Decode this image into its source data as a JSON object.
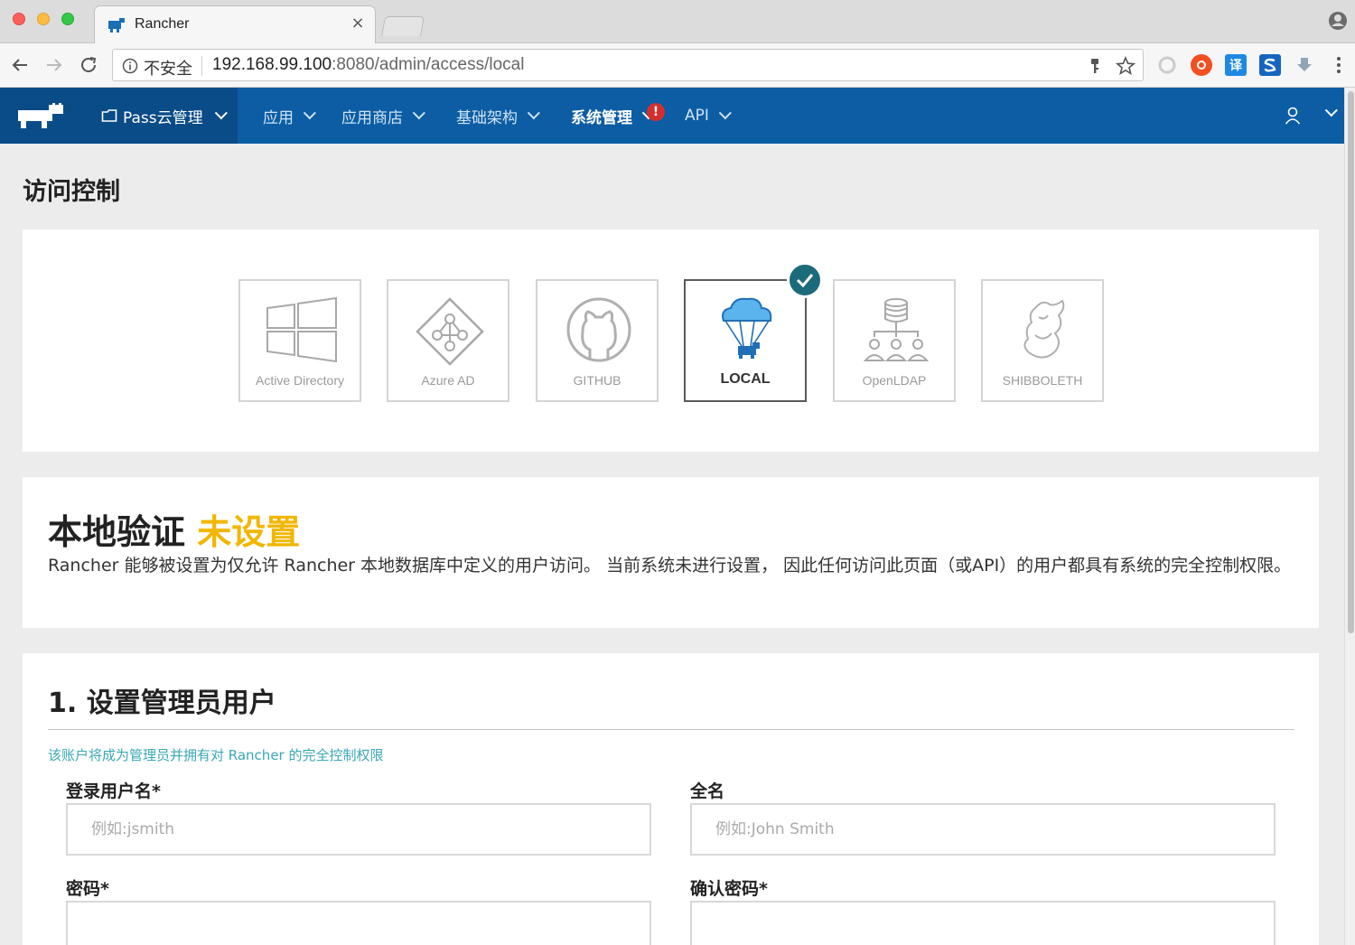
{
  "browser": {
    "tab_title": "Rancher",
    "tab_close": "×",
    "security_label": "不安全",
    "url_host": "192.168.99.100",
    "url_rest": ":8080/admin/access/local",
    "extension_translate": "译"
  },
  "header": {
    "env_label": "Pass云管理",
    "nav": [
      {
        "label": "应用"
      },
      {
        "label": "应用商店"
      },
      {
        "label": "基础架构"
      },
      {
        "label": "系统管理",
        "active": true
      },
      {
        "label": "API"
      }
    ],
    "alert_badge": "!"
  },
  "page": {
    "title": "访问控制"
  },
  "providers": [
    {
      "label": "Active Directory",
      "icon": "windows-icon"
    },
    {
      "label": "Azure AD",
      "icon": "azure-icon"
    },
    {
      "label": "GITHUB",
      "icon": "github-icon"
    },
    {
      "label": "LOCAL",
      "icon": "local-cloud-icon",
      "selected": true
    },
    {
      "label": "OpenLDAP",
      "icon": "ldap-icon"
    },
    {
      "label": "SHIBBOLETH",
      "icon": "shibboleth-icon"
    }
  ],
  "status": {
    "title": "本地验证",
    "state": "未设置",
    "description": "Rancher 能够被设置为仅允许 Rancher 本地数据库中定义的用户访问。 当前系统未进行设置， 因此任何访问此页面（或API）的用户都具有系统的完全控制权限。"
  },
  "form": {
    "title": "1. 设置管理员用户",
    "help": "该账户将成为管理员并拥有对 Rancher 的完全控制权限",
    "username_label": "登录用户名*",
    "username_placeholder": "例如:jsmith",
    "fullname_label": "全名",
    "fullname_placeholder": "例如:John Smith",
    "password_label": "密码*",
    "confirm_label": "确认密码*"
  },
  "colors": {
    "header_bg": "#0c5da4",
    "header_dark": "#0a4c87",
    "warning": "#f2b600",
    "help_text": "#3aa7b5",
    "check_badge": "#1c6b7a"
  }
}
